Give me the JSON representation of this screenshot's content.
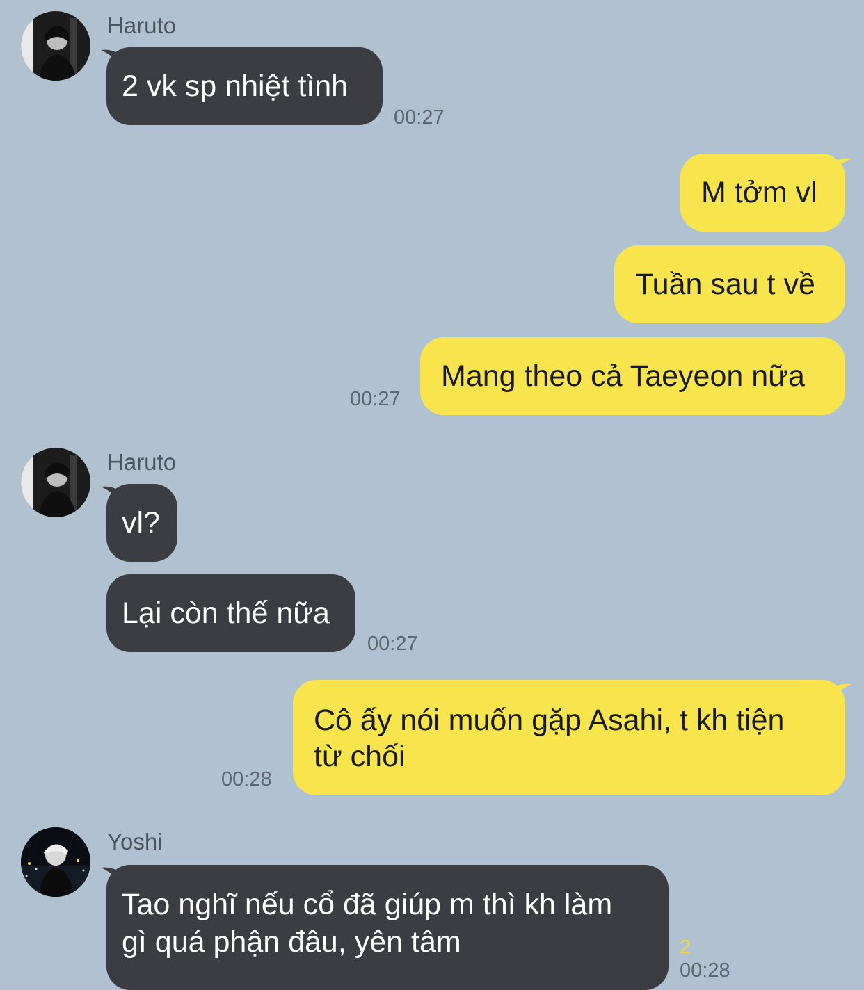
{
  "colors": {
    "background": "#b0c2d1",
    "incoming_bubble": "#3b3d42",
    "outgoing_bubble": "#f8e54d",
    "unread_count": "#f0d640"
  },
  "messages": [
    {
      "sender": "Haruto",
      "avatar_icon": "profile-photo-icon",
      "text": "2 vk sp nhiệt tình",
      "time": "00:27"
    },
    {
      "text": "M tởm vl"
    },
    {
      "text": "Tuần sau t về"
    },
    {
      "text": "Mang theo cả Taeyeon nữa",
      "time": "00:27"
    },
    {
      "sender": "Haruto",
      "avatar_icon": "profile-photo-icon",
      "text": "vl?"
    },
    {
      "text": "Lại còn thế nữa",
      "time": "00:27"
    },
    {
      "text_line1": "Cô ấy nói muốn gặp Asahi, t kh tiện",
      "text_line2": "từ chối",
      "time": "00:28"
    },
    {
      "sender": "Yoshi",
      "avatar_icon": "profile-photo-icon",
      "text_line1": "Tao nghĩ nếu cổ đã giúp m thì kh làm",
      "text_line2": "gì quá phận đâu, yên tâm",
      "unread": "2",
      "time": "00:28"
    }
  ]
}
